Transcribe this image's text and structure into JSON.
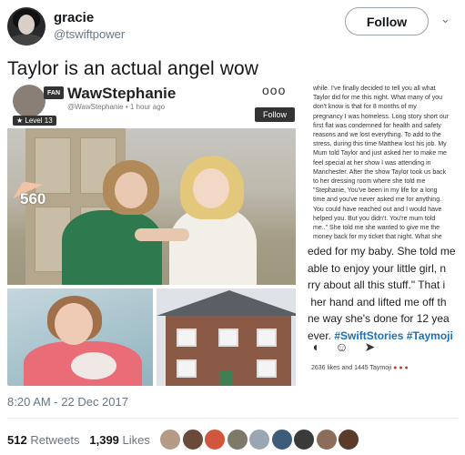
{
  "user": {
    "display_name": "gracie",
    "handle": "@tswiftpower",
    "follow_label": "Follow"
  },
  "tweet": {
    "text": "Taylor is an actual angel wow",
    "timestamp": "8:20 AM - 22 Dec 2017",
    "retweets_count": "512",
    "retweets_label": "Retweets",
    "likes_count": "1,399",
    "likes_label": "Likes"
  },
  "media": {
    "post_author": "WawStephanie",
    "post_subline": "@WawStephanie • 1 hour ago",
    "level_badge": "★ Level 13",
    "fan_badge": "FAN",
    "dots": "ooo",
    "follow_label": "Follow",
    "likes_overlay": "560",
    "small_text": "while. I've finally decided to tell you all what\nTaylor did for me this night. What many of you\ndon't know is that for 8 months of my\npregnancy I was homeless. Long story short our\nfirst flat was condemned for health and safety\nreasons and we lost everything. To add to the\nstress, during this time Matthew lost his job. My\nMum told Taylor and just asked her to make me\nfeel special at her show I was attending in\nManchester. After the show Taylor took us back\nto her dressing room where she told me\n\"Stephanie, You've been in my life for a long\ntime and you've never asked me for anything.\nYou could have reached out and I would have\nhelped you. But you didn't. You're mum told\nme..\" She told me she wanted to give me the\nmoney back for my ticket that night. What she",
    "big_text": "eded for my baby. She told me\nable to enjoy your little girl, n\nrry about all this stuff.\" That i\n her hand and lifted me off th\nne way she's done for 12 yea\never. ",
    "hashtags": "#SwiftStories #Taymoji",
    "bottom_line": "2636 likes and 1445 Taymoji"
  },
  "colors": {
    "accent": "#1da1f2",
    "muted": "#657786",
    "hashtag": "#1e6fb8"
  },
  "likers": [
    {
      "color": "#b39b86"
    },
    {
      "color": "#6b4a3a"
    },
    {
      "color": "#d0573b"
    },
    {
      "color": "#7d7a6a"
    },
    {
      "color": "#9aa6b1"
    },
    {
      "color": "#3d5c7a"
    },
    {
      "color": "#3a3a3a"
    },
    {
      "color": "#8c6d5a"
    },
    {
      "color": "#5b3b2a"
    }
  ]
}
